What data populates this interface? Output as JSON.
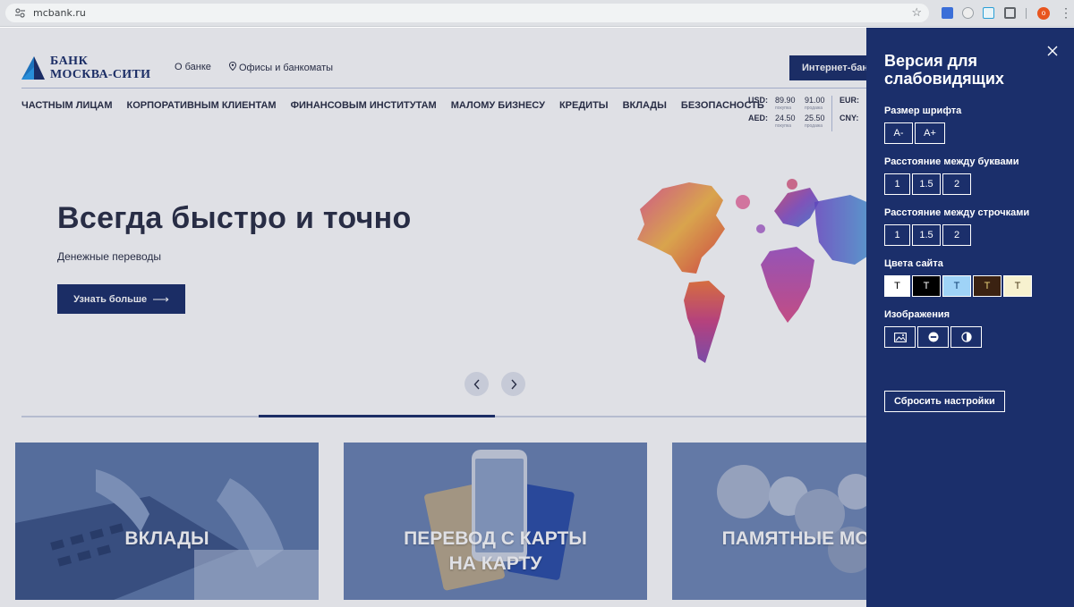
{
  "browser": {
    "url": "mcbank.ru"
  },
  "header": {
    "logo_line1": "БАНК",
    "logo_line2": "МОСКВА-СИТИ",
    "about_link": "О банке",
    "offices_link": "Офисы и банкоматы",
    "internet_bank": "Интернет-банк"
  },
  "nav": [
    "ЧАСТНЫМ ЛИЦАМ",
    "КОРПОРАТИВНЫМ КЛИЕНТАМ",
    "ФИНАНСОВЫМ ИНСТИТУТАМ",
    "МАЛОМУ БИЗНЕСУ",
    "КРЕДИТЫ",
    "ВКЛАДЫ",
    "БЕЗОПАСНОСТЬ"
  ],
  "rates": {
    "usd": {
      "code": "USD:",
      "buy": "89.90",
      "sell": "91.00"
    },
    "aed": {
      "code": "AED:",
      "buy": "24.50",
      "sell": "25.50"
    },
    "buy_caption": "покупка",
    "sell_caption": "продажа",
    "eur_code": "EUR:",
    "cny_code": "CNY:"
  },
  "hero": {
    "title": "Всегда быстро и точно",
    "subtitle": "Денежные переводы",
    "button": "Узнать больше"
  },
  "cards": [
    {
      "line1": "ВКЛАДЫ",
      "line2": ""
    },
    {
      "line1": "ПЕРЕВОД С КАРТЫ",
      "line2": "НА КАРТУ"
    },
    {
      "line1": "ПАМЯТНЫЕ МОНЕТЫ",
      "line2": ""
    }
  ],
  "accessibility": {
    "title": "Версия для слабовидящих",
    "font_size_label": "Размер шрифта",
    "font_minus": "A-",
    "font_plus": "A+",
    "letter_spacing_label": "Расстояние между буквами",
    "line_spacing_label": "Расстояние между строчками",
    "spacing_options": [
      "1",
      "1.5",
      "2"
    ],
    "colors_label": "Цвета сайта",
    "color_options": [
      {
        "text": "T",
        "bg": "#ffffff",
        "fg": "#000000"
      },
      {
        "text": "T",
        "bg": "#000000",
        "fg": "#ffffff"
      },
      {
        "text": "T",
        "bg": "#9fd3f7",
        "fg": "#0b3b6e"
      },
      {
        "text": "T",
        "bg": "#3b2212",
        "fg": "#e8d27a"
      },
      {
        "text": "T",
        "bg": "#f7f1cf",
        "fg": "#4a3a1a"
      }
    ],
    "images_label": "Изображения",
    "image_options": [
      "image-icon",
      "minus-circle-icon",
      "half-circle-icon"
    ],
    "reset": "Сбросить настройки"
  },
  "colors": {
    "brand": "#1b2f6b",
    "panel": "#1b2f6b"
  }
}
